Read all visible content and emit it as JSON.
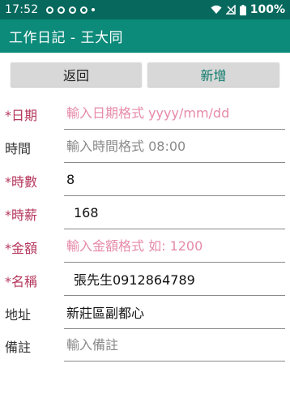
{
  "status_bar": {
    "time": "17:52",
    "notification_icons": [
      "circle-notification-icon",
      "circle-notification-icon",
      "circle-notification-icon",
      "circle-notification-icon",
      "dot-icon"
    ],
    "battery": "100%",
    "right_icons": [
      "wifi-icon",
      "signal-off-icon",
      "battery-icon"
    ]
  },
  "app_bar": {
    "title": "工作日記 - 王大同"
  },
  "buttons": {
    "back": "返回",
    "add": "新增"
  },
  "form": {
    "date": {
      "label": "*日期",
      "value": "",
      "placeholder": "輸入日期格式 yyyy/mm/dd"
    },
    "time": {
      "label": "時間",
      "value": "",
      "placeholder": "輸入時間格式 08:00"
    },
    "hours": {
      "label": "*時數",
      "value": "8",
      "placeholder": ""
    },
    "wage": {
      "label": "*時薪",
      "value": "168",
      "placeholder": ""
    },
    "amount": {
      "label": "*金額",
      "value": "",
      "placeholder": "輸入金額格式 如: 1200"
    },
    "name": {
      "label": "*名稱",
      "value": "張先生0912864789",
      "placeholder": ""
    },
    "address": {
      "label": "地址",
      "value": "新莊區副都心",
      "placeholder": ""
    },
    "note": {
      "label": "備註",
      "value": "",
      "placeholder": "輸入備註"
    }
  },
  "colors": {
    "status_bar": "#07695e",
    "app_bar": "#0c8a7a",
    "required_label": "#b5375c",
    "hint_pink": "#e68aa8",
    "accent_text": "#0c7a6b"
  }
}
